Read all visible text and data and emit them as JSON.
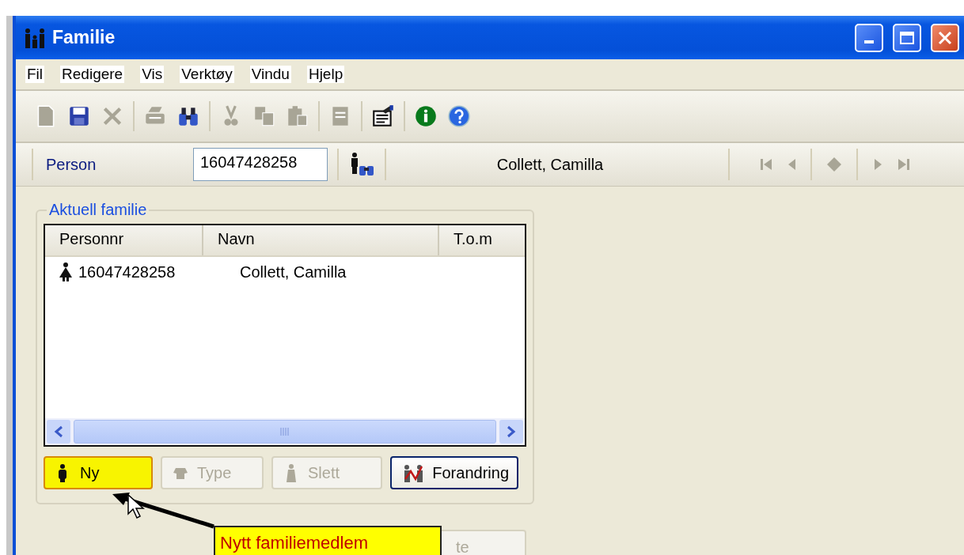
{
  "window": {
    "title": "Familie"
  },
  "menu": [
    "Fil",
    "Redigere",
    "Vis",
    "Verktøy",
    "Vindu",
    "Hjelp"
  ],
  "toolbar": [
    {
      "kind": "button",
      "disabled": true
    },
    {
      "kind": "button",
      "disabled": false
    },
    {
      "kind": "button",
      "disabled": true
    },
    {
      "kind": "separator"
    },
    {
      "kind": "button",
      "disabled": true
    },
    {
      "kind": "button",
      "disabled": false
    },
    {
      "kind": "separator"
    },
    {
      "kind": "button",
      "disabled": true
    },
    {
      "kind": "button",
      "disabled": true
    },
    {
      "kind": "button",
      "disabled": true
    },
    {
      "kind": "separator"
    },
    {
      "kind": "button",
      "disabled": true
    },
    {
      "kind": "separator"
    },
    {
      "kind": "button",
      "disabled": false
    },
    {
      "kind": "separator"
    },
    {
      "kind": "button",
      "disabled": false
    },
    {
      "kind": "button",
      "disabled": false
    }
  ],
  "person_bar": {
    "label": "Person",
    "number": "16047428258",
    "name": "Collett, Camilla"
  },
  "family": {
    "legend": "Aktuell familie",
    "columns": [
      "Personnr",
      "Navn",
      "T.o.m"
    ],
    "rows": [
      {
        "personnr": "16047428258",
        "navn": "Collett, Camilla"
      }
    ],
    "buttons": [
      {
        "label": "Ny",
        "disabled": false,
        "highlighted": true
      },
      {
        "label": "Type",
        "disabled": true,
        "highlighted": false
      },
      {
        "label": "Slett",
        "disabled": true,
        "highlighted": false
      },
      {
        "label": "Forandring",
        "disabled": false,
        "highlighted": false
      }
    ]
  },
  "partial_button": {
    "label": "te",
    "disabled": true
  },
  "callout": {
    "text": "Nytt familiemedlem"
  }
}
